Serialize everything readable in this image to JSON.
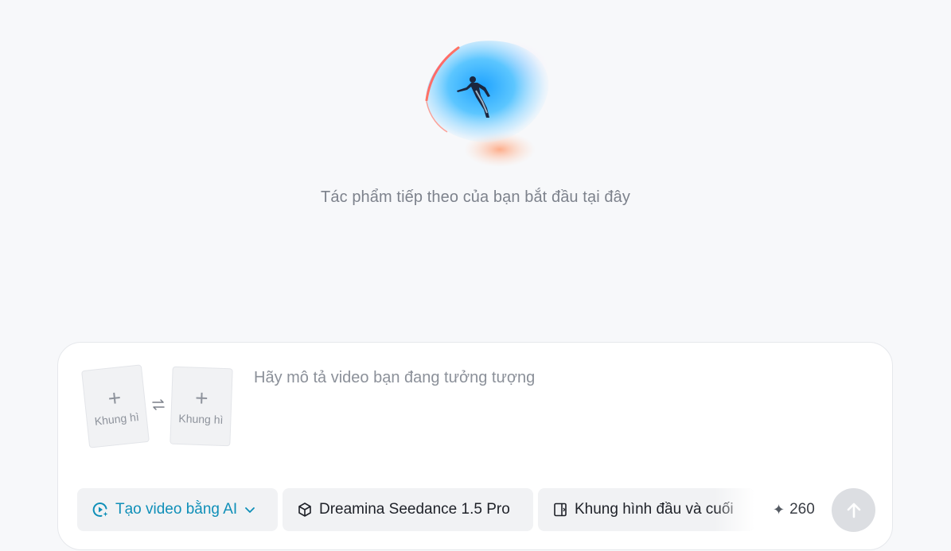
{
  "hero": {
    "tagline": "Tác phẩm tiếp theo của bạn bắt đầu tại đây"
  },
  "composer": {
    "frames": [
      {
        "plus": "+",
        "label": "Khung hì"
      },
      {
        "plus": "+",
        "label": "Khung hì"
      }
    ],
    "prompt_placeholder": "Hãy mô tả video bạn đang tưởng tượng"
  },
  "toolbar": {
    "mode_label": "Tạo video bằng AI",
    "model_label": "Dreamina Seedance 1.5 Pro",
    "frames_label": "Khung hình đầu và cuối",
    "credits_symbol": "✦",
    "credits_value": "260"
  },
  "colors": {
    "accent": "#0f8fb8",
    "background": "#f7f8fa",
    "chip_bg": "#f1f2f4",
    "send_disabled": "#dcdee2"
  },
  "icons": {
    "mode": "video-sparkle-icon",
    "mode_chevron": "chevron-down-icon",
    "model": "cube-icon",
    "frames": "frame-panel-icon",
    "swap": "swap-arrows-icon",
    "send": "arrow-up-icon"
  }
}
